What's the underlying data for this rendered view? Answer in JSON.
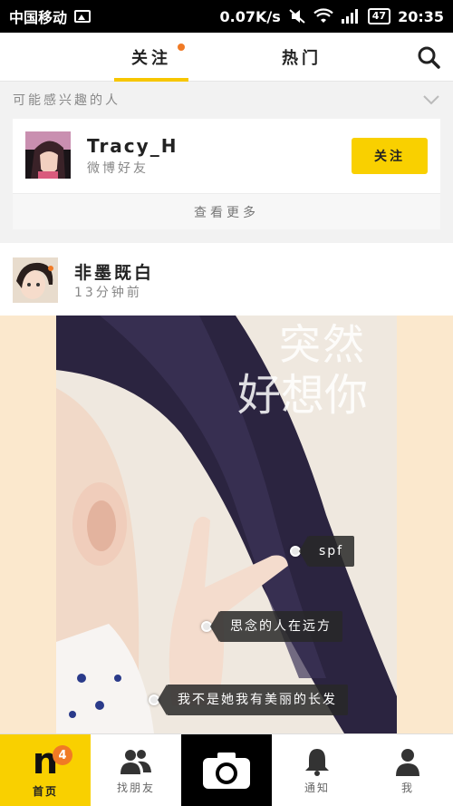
{
  "status_bar": {
    "carrier": "中国移动",
    "speed": "0.07K/s",
    "battery": "47",
    "time": "20:35"
  },
  "tabs": {
    "follow": "关注",
    "hot": "热门"
  },
  "suggestions": {
    "heading": "可能感兴趣的人",
    "user": {
      "name": "Tracy_H",
      "subtitle": "微博好友",
      "follow_label": "关注"
    },
    "see_more": "查看更多"
  },
  "post": {
    "author": "非墨既白",
    "time": "13分钟前",
    "photo_text_line1": "突然",
    "photo_text_line2": "好想你",
    "tags": [
      "spf",
      "思念的人在远方",
      "我不是她我有美丽的长发"
    ]
  },
  "bottom_nav": {
    "home_label": "首页",
    "home_badge": "4",
    "friends_label": "找朋友",
    "notify_label": "通知",
    "me_label": "我"
  },
  "colors": {
    "accent_yellow": "#f9d000",
    "badge_orange": "#f07a25"
  }
}
